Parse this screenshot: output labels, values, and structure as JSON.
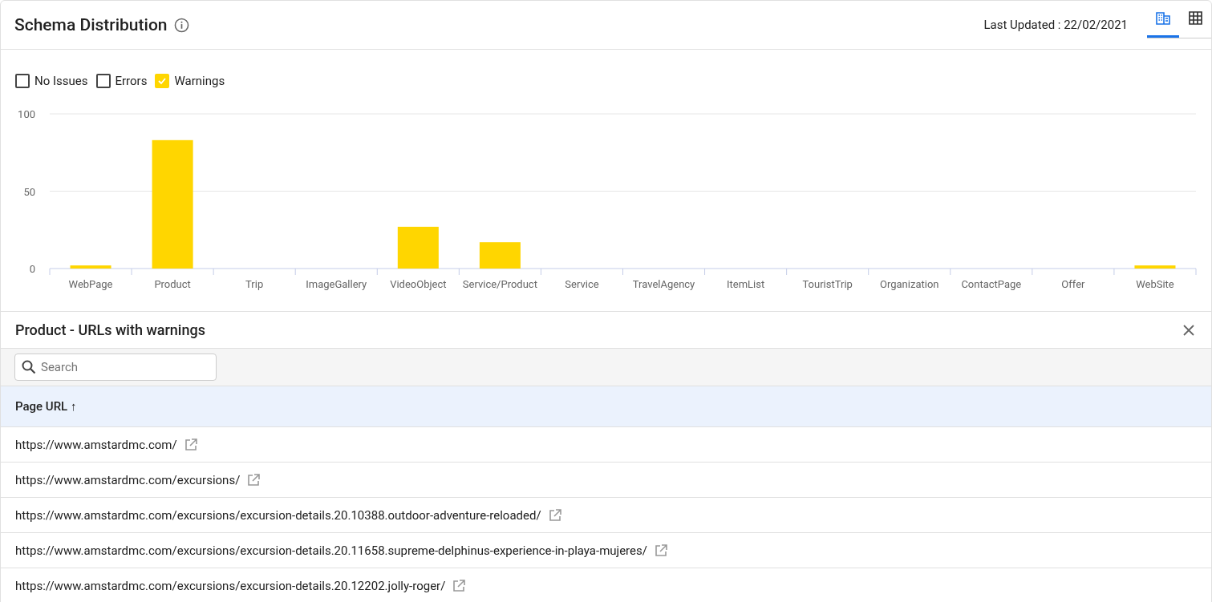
{
  "header": {
    "title": "Schema Distribution",
    "last_updated": "Last Updated : 22/02/2021",
    "view_toggle": [
      {
        "kind": "chart",
        "selected": true
      },
      {
        "kind": "table",
        "selected": false
      }
    ]
  },
  "legend": [
    {
      "label": "No Issues",
      "checked": false
    },
    {
      "label": "Errors",
      "checked": false
    },
    {
      "label": "Warnings",
      "checked": true
    }
  ],
  "chart_data": {
    "type": "bar",
    "categories": [
      "WebPage",
      "Product",
      "Trip",
      "ImageGallery",
      "VideoObject",
      "Service/Product",
      "Service",
      "TravelAgency",
      "ItemList",
      "TouristTrip",
      "Organization",
      "ContactPage",
      "Offer",
      "WebSite"
    ],
    "series": [
      {
        "color": "#ffd600",
        "values": [
          2,
          83,
          0,
          0,
          27,
          17,
          0,
          0,
          0,
          0,
          0,
          0,
          0,
          2
        ]
      }
    ],
    "ylim": [
      0,
      100
    ],
    "yticks": [
      0,
      50,
      100
    ]
  },
  "detail": {
    "title": "Product - URLs with warnings",
    "search": {
      "placeholder": "Search"
    },
    "table": {
      "columns": [
        {
          "label": "Page URL",
          "sort_indicator": "↑"
        }
      ],
      "rows": [
        "https://www.amstardmc.com/",
        "https://www.amstardmc.com/excursions/",
        "https://www.amstardmc.com/excursions/excursion-details.20.10388.outdoor-adventure-reloaded/",
        "https://www.amstardmc.com/excursions/excursion-details.20.11658.supreme-delphinus-experience-in-playa-mujeres/",
        "https://www.amstardmc.com/excursions/excursion-details.20.12202.jolly-roger/"
      ]
    }
  }
}
